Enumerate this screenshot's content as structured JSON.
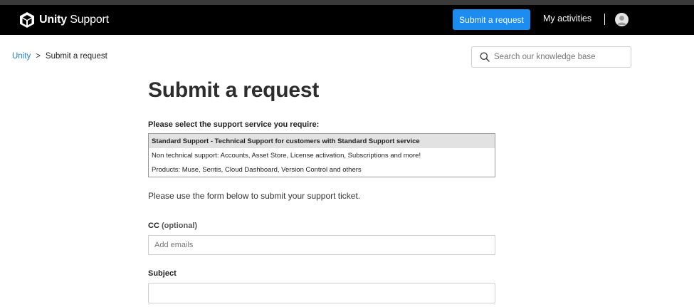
{
  "header": {
    "logo_bold": "Unity",
    "logo_regular": " Support",
    "submit_request_label": "Submit a request",
    "my_activities_label": "My activities",
    "logo_icon": "unity-cube-icon",
    "avatar_icon": "user-avatar-icon"
  },
  "breadcrumb": {
    "items": [
      {
        "label": "Unity"
      },
      {
        "label": "Submit a request"
      }
    ],
    "separator": ">"
  },
  "search": {
    "placeholder": "Search our knowledge base",
    "value": "",
    "icon": "search-icon"
  },
  "main": {
    "title": "Submit a request",
    "service_label": "Please select the support service you require:",
    "services": [
      {
        "label": "Standard Support - Technical Support for customers with Standard Support service",
        "selected": true
      },
      {
        "label": "Non technical support: Accounts, Asset Store, License activation, Subscriptions and more!",
        "selected": false
      },
      {
        "label": "Products: Muse, Sentis, Cloud Dashboard, Version Control and others",
        "selected": false
      }
    ],
    "instructions": "Please use the form below to submit your support ticket.",
    "cc_label": "CC",
    "cc_optional": "(optional)",
    "cc_placeholder": "Add emails",
    "subject_label": "Subject",
    "subject_value": ""
  },
  "colors": {
    "header_bg": "#000000",
    "accent": "#1c8cf0",
    "link": "#1c7fd6",
    "selected_bg": "#e2e2e2"
  }
}
